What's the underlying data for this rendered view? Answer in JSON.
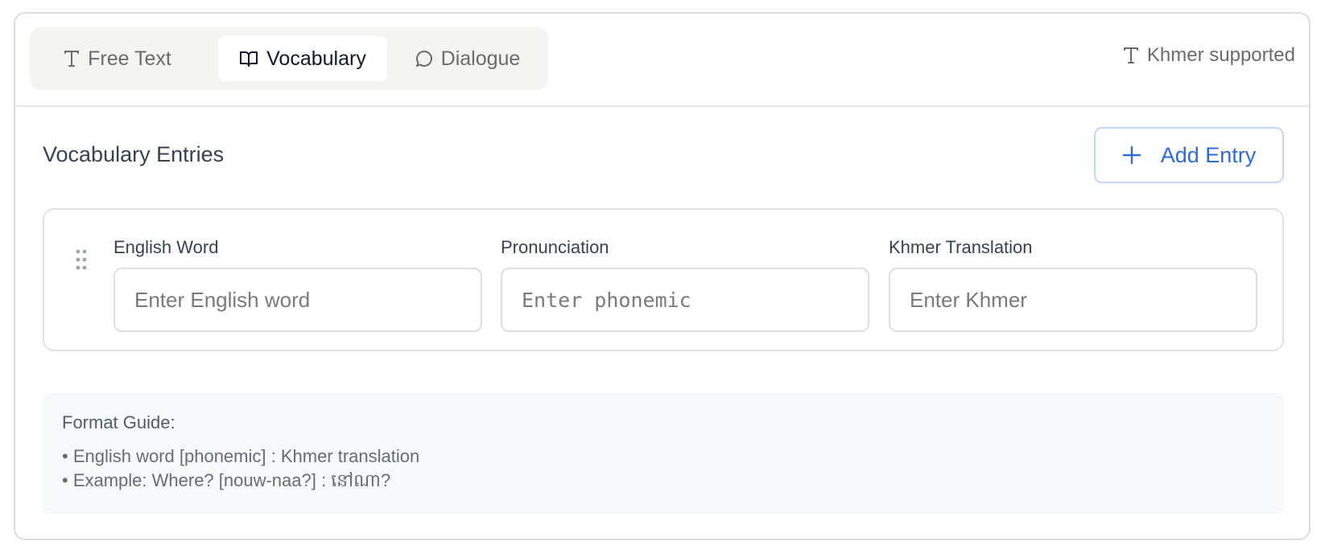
{
  "tabs": [
    {
      "label": "Free Text",
      "icon": "text-type-icon",
      "active": false
    },
    {
      "label": "Vocabulary",
      "icon": "book-open-icon",
      "active": true
    },
    {
      "label": "Dialogue",
      "icon": "message-circle-icon",
      "active": false
    }
  ],
  "khmer_support": {
    "label": "Khmer supported",
    "icon": "text-type-icon"
  },
  "section": {
    "title": "Vocabulary Entries"
  },
  "add_entry": {
    "label": "Add Entry",
    "icon": "plus-icon",
    "color": "#2f6bd8"
  },
  "entry": {
    "english": {
      "label": "English Word",
      "placeholder": "Enter English word",
      "value": ""
    },
    "pronunciation": {
      "label": "Pronunciation",
      "placeholder": "Enter phonemic",
      "value": ""
    },
    "khmer": {
      "label": "Khmer Translation",
      "placeholder": "Enter Khmer",
      "value": ""
    }
  },
  "guide": {
    "title": "Format Guide:",
    "lines": [
      "• English word [phonemic] : Khmer translation",
      "• Example: Where? [nouw-naa?] : នៅណា?"
    ]
  }
}
